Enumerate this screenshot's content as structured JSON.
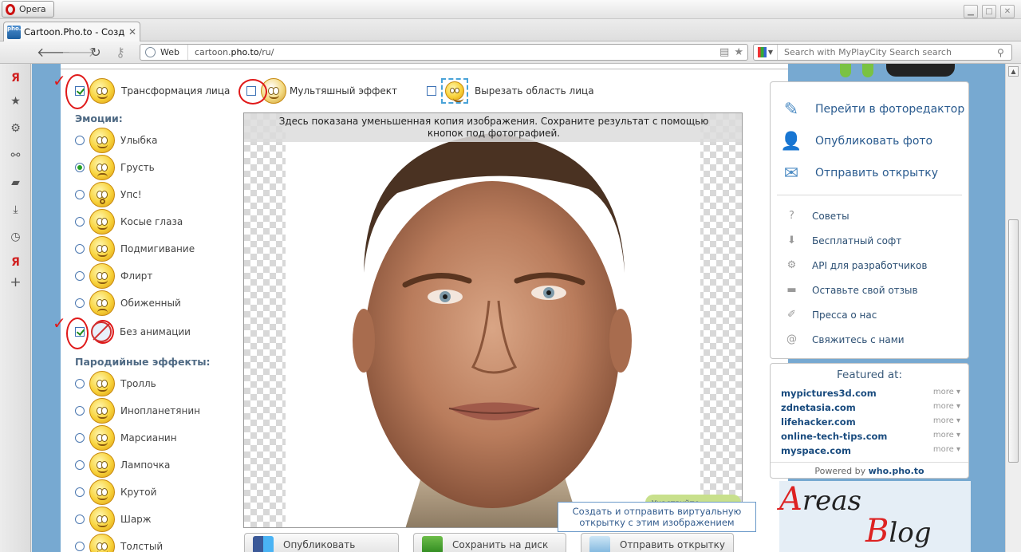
{
  "browser": {
    "menu_label": "Opera",
    "tab_title": "Cartoon.Pho.to - Созда...",
    "tab_favicon_text": "pho.to",
    "address_scheme_label": "Web",
    "address_host": "cartoon.",
    "address_host_bold": "pho.to",
    "address_path": "/ru/",
    "search_placeholder": "Search with MyPlayCity Search search"
  },
  "options": {
    "face_transform": "Трансформация лица",
    "cartoon_effect": "Мультяшный эффект",
    "crop_face": "Вырезать область лица"
  },
  "emotions": {
    "heading": "Эмоции:",
    "items": [
      {
        "label": "Улыбка",
        "selected": false
      },
      {
        "label": "Грусть",
        "selected": true
      },
      {
        "label": "Упс!",
        "selected": false
      },
      {
        "label": "Косые глаза",
        "selected": false
      },
      {
        "label": "Подмигивание",
        "selected": false
      },
      {
        "label": "Флирт",
        "selected": false
      },
      {
        "label": "Обиженный",
        "selected": false
      }
    ],
    "no_animation": "Без анимации"
  },
  "parody": {
    "heading": "Пародийные эффекты:",
    "items": [
      "Тролль",
      "Инопланетянин",
      "Марсианин",
      "Лампочка",
      "Крутой",
      "Шарж",
      "Толстый"
    ]
  },
  "image": {
    "notice": "Здесь показана уменьшенная копия изображения. Сохраните результат с помощью кнопок под фотографией.",
    "badge": "Участвуйте"
  },
  "tooltip": "Создать и отправить виртуальную открытку с этим изображением",
  "buttons": {
    "publish": "Опубликовать",
    "save": "Сохранить на диск",
    "send": "Отправить открытку"
  },
  "sidebar": {
    "big_links": [
      "Перейти в фоторедактор",
      "Опубликовать фото",
      "Отправить открытку"
    ],
    "small_links": [
      "Советы",
      "Бесплатный софт",
      "API для разработчиков",
      "Оставьте свой отзыв",
      "Пресса о нас",
      "Свяжитесь с нами"
    ]
  },
  "featured": {
    "heading": "Featured at:",
    "items": [
      {
        "name": "mypictures3d.com",
        "more": "more"
      },
      {
        "name": "zdnetasia.com",
        "more": "more"
      },
      {
        "name": "lifehacker.com",
        "more": "more"
      },
      {
        "name": "online-tech-tips.com",
        "more": "more"
      },
      {
        "name": "myspace.com",
        "more": "more"
      }
    ],
    "powered_prefix": "Powered by ",
    "powered_link": "who.pho.to"
  },
  "watermark": {
    "line1_initial": "A",
    "line1_rest": "reas",
    "line2_initial": "B",
    "line2_rest": "log"
  },
  "colors": {
    "page_bg": "#77a9d1",
    "link_blue": "#2a5b8f",
    "annotation_red": "#e01919"
  }
}
